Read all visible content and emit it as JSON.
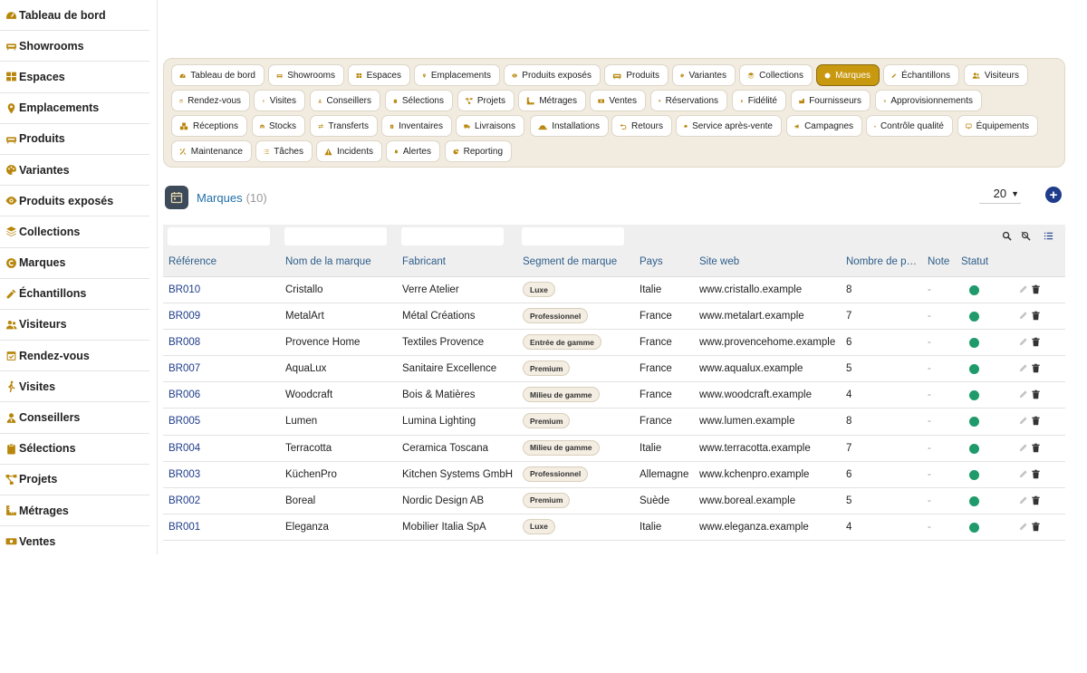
{
  "sidebar": {
    "items": [
      {
        "label": "Tableau de bord",
        "icon": "dashboard-icon"
      },
      {
        "label": "Showrooms",
        "icon": "couch-icon"
      },
      {
        "label": "Espaces",
        "icon": "grid-icon"
      },
      {
        "label": "Emplacements",
        "icon": "map-pin-icon"
      },
      {
        "label": "Produits",
        "icon": "couch-icon"
      },
      {
        "label": "Variantes",
        "icon": "palette-icon"
      },
      {
        "label": "Produits exposés",
        "icon": "eye-icon"
      },
      {
        "label": "Collections",
        "icon": "layers-icon"
      },
      {
        "label": "Marques",
        "icon": "copyright-icon"
      },
      {
        "label": "Échantillons",
        "icon": "eyedropper-icon"
      },
      {
        "label": "Visiteurs",
        "icon": "users-icon"
      },
      {
        "label": "Rendez-vous",
        "icon": "calendar-check-icon"
      },
      {
        "label": "Visites",
        "icon": "walking-icon"
      },
      {
        "label": "Conseillers",
        "icon": "user-tie-icon"
      },
      {
        "label": "Sélections",
        "icon": "clipboard-icon"
      },
      {
        "label": "Projets",
        "icon": "project-diagram-icon"
      },
      {
        "label": "Métrages",
        "icon": "ruler-icon"
      },
      {
        "label": "Ventes",
        "icon": "cash-icon"
      }
    ]
  },
  "nav": {
    "chips": [
      {
        "label": "Tableau de bord",
        "icon": "dashboard-icon"
      },
      {
        "label": "Showrooms",
        "icon": "couch-icon"
      },
      {
        "label": "Espaces",
        "icon": "grid-icon"
      },
      {
        "label": "Emplacements",
        "icon": "map-pin-icon"
      },
      {
        "label": "Produits exposés",
        "icon": "eye-icon"
      },
      {
        "label": "Produits",
        "icon": "couch-icon"
      },
      {
        "label": "Variantes",
        "icon": "palette-icon"
      },
      {
        "label": "Collections",
        "icon": "layers-icon"
      },
      {
        "label": "Marques",
        "icon": "copyright-icon",
        "active": true
      },
      {
        "label": "Échantillons",
        "icon": "eyedropper-icon"
      },
      {
        "label": "Visiteurs",
        "icon": "users-icon"
      },
      {
        "label": "Rendez-vous",
        "icon": "calendar-check-icon"
      },
      {
        "label": "Visites",
        "icon": "walking-icon"
      },
      {
        "label": "Conseillers",
        "icon": "user-tie-icon"
      },
      {
        "label": "Sélections",
        "icon": "clipboard-icon"
      },
      {
        "label": "Projets",
        "icon": "project-diagram-icon"
      },
      {
        "label": "Métrages",
        "icon": "ruler-icon"
      },
      {
        "label": "Ventes",
        "icon": "cash-icon"
      },
      {
        "label": "Réservations",
        "icon": "bookmark-icon"
      },
      {
        "label": "Fidélité",
        "icon": "award-icon"
      },
      {
        "label": "Fournisseurs",
        "icon": "industry-icon"
      },
      {
        "label": "Approvisionnements",
        "icon": "dolly-icon"
      },
      {
        "label": "Réceptions",
        "icon": "boxes-icon"
      },
      {
        "label": "Stocks",
        "icon": "warehouse-icon"
      },
      {
        "label": "Transferts",
        "icon": "exchange-icon"
      },
      {
        "label": "Inventaires",
        "icon": "clipboard-list-icon"
      },
      {
        "label": "Livraisons",
        "icon": "truck-icon"
      },
      {
        "label": "Installations",
        "icon": "hard-hat-icon"
      },
      {
        "label": "Retours",
        "icon": "undo-icon"
      },
      {
        "label": "Service après-vente",
        "icon": "comment-icon"
      },
      {
        "label": "Campagnes",
        "icon": "bullhorn-icon"
      },
      {
        "label": "Contrôle qualité",
        "icon": "clipboard-check-icon"
      },
      {
        "label": "Équipements",
        "icon": "desktop-icon"
      },
      {
        "label": "Maintenance",
        "icon": "tools-icon"
      },
      {
        "label": "Tâches",
        "icon": "tasks-icon"
      },
      {
        "label": "Incidents",
        "icon": "warning-icon"
      },
      {
        "label": "Alertes",
        "icon": "bell-icon"
      },
      {
        "label": "Reporting",
        "icon": "chart-pie-icon"
      }
    ]
  },
  "page": {
    "title": "Marques",
    "count": "(10)",
    "page_size": "20",
    "add_label": "+"
  },
  "table": {
    "columns": [
      "Référence",
      "Nom de la marque",
      "Fabricant",
      "Segment de marque",
      "Pays",
      "Site web",
      "Nombre de p…",
      "Note",
      "Statut"
    ],
    "rows": [
      {
        "ref": "BR010",
        "name": "Cristallo",
        "maker": "Verre Atelier",
        "segment": "Luxe",
        "country": "Italie",
        "site": "www.cristallo.example",
        "count": "8",
        "note": "-"
      },
      {
        "ref": "BR009",
        "name": "MetalArt",
        "maker": "Métal Créations",
        "segment": "Professionnel",
        "country": "France",
        "site": "www.metalart.example",
        "count": "7",
        "note": "-"
      },
      {
        "ref": "BR008",
        "name": "Provence Home",
        "maker": "Textiles Provence",
        "segment": "Entrée de gamme",
        "country": "France",
        "site": "www.provencehome.example",
        "count": "6",
        "note": "-"
      },
      {
        "ref": "BR007",
        "name": "AquaLux",
        "maker": "Sanitaire Excellence",
        "segment": "Premium",
        "country": "France",
        "site": "www.aqualux.example",
        "count": "5",
        "note": "-"
      },
      {
        "ref": "BR006",
        "name": "Woodcraft",
        "maker": "Bois & Matières",
        "segment": "Milieu de gamme",
        "country": "France",
        "site": "www.woodcraft.example",
        "count": "4",
        "note": "-"
      },
      {
        "ref": "BR005",
        "name": "Lumen",
        "maker": "Lumina Lighting",
        "segment": "Premium",
        "country": "France",
        "site": "www.lumen.example",
        "count": "8",
        "note": "-"
      },
      {
        "ref": "BR004",
        "name": "Terracotta",
        "maker": "Ceramica Toscana",
        "segment": "Milieu de gamme",
        "country": "Italie",
        "site": "www.terracotta.example",
        "count": "7",
        "note": "-"
      },
      {
        "ref": "BR003",
        "name": "KüchenPro",
        "maker": "Kitchen Systems GmbH",
        "segment": "Professionnel",
        "country": "Allemagne",
        "site": "www.kchenpro.example",
        "count": "6",
        "note": "-"
      },
      {
        "ref": "BR002",
        "name": "Boreal",
        "maker": "Nordic Design AB",
        "segment": "Premium",
        "country": "Suède",
        "site": "www.boreal.example",
        "count": "5",
        "note": "-"
      },
      {
        "ref": "BR001",
        "name": "Eleganza",
        "maker": "Mobilier Italia SpA",
        "segment": "Luxe",
        "country": "Italie",
        "site": "www.eleganza.example",
        "count": "4",
        "note": "-"
      }
    ]
  },
  "colors": {
    "accent": "#c8980f",
    "link": "#1f3c8a",
    "status_active": "#1f9a6b",
    "panel_bg": "#f2ece0"
  }
}
